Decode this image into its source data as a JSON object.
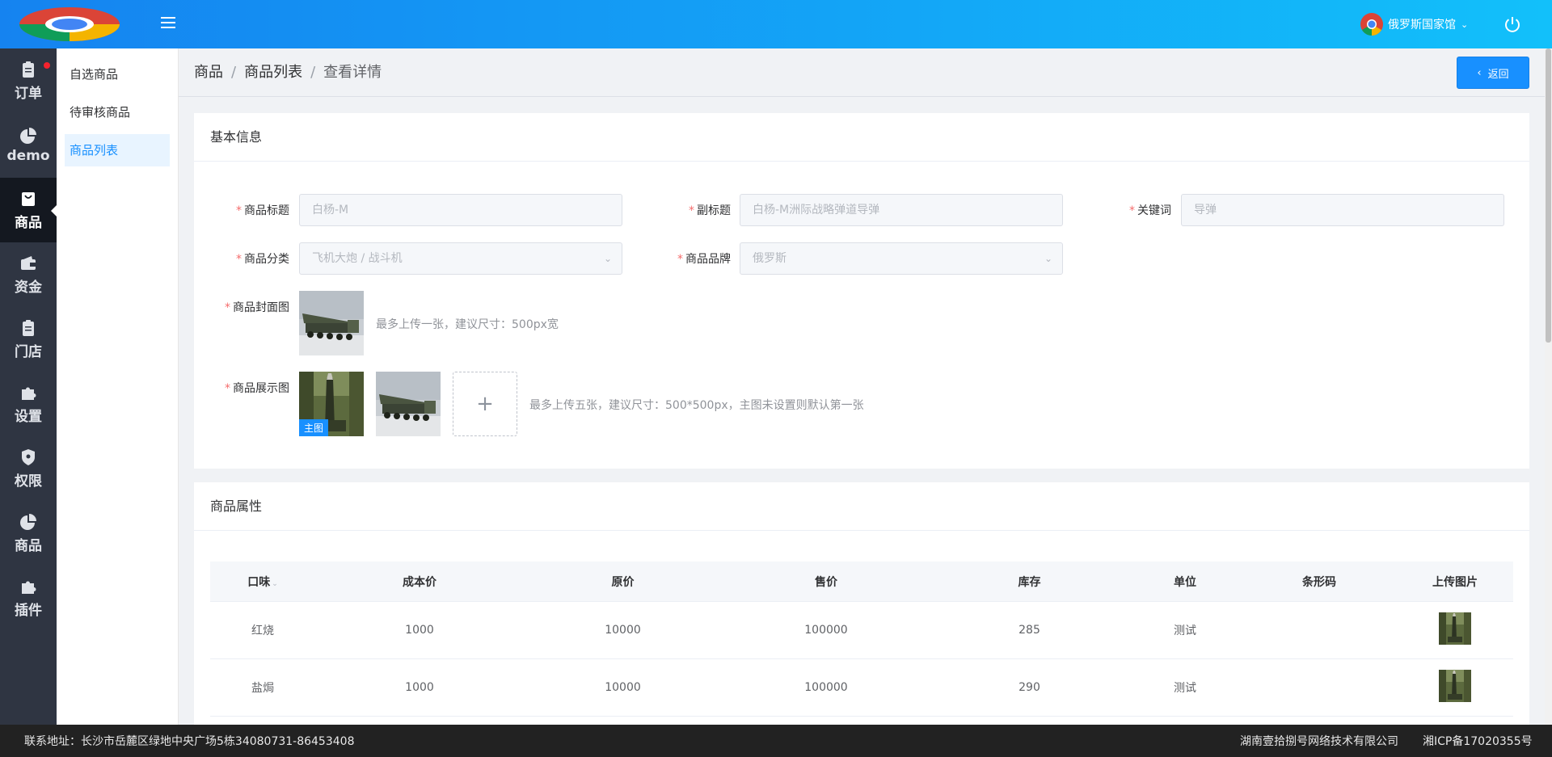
{
  "header": {
    "store_name": "俄罗斯国家馆"
  },
  "leftnav": {
    "items": [
      {
        "label": "订单",
        "icon": "clipboard-icon"
      },
      {
        "label": "demo",
        "icon": "pie-chart-icon"
      },
      {
        "label": "商品",
        "icon": "shopping-bag-icon"
      },
      {
        "label": "资金",
        "icon": "wallet-icon"
      },
      {
        "label": "门店",
        "icon": "clipboard-icon"
      },
      {
        "label": "设置",
        "icon": "puzzle-icon"
      },
      {
        "label": "权限",
        "icon": "shield-icon"
      },
      {
        "label": "商品",
        "icon": "pie-chart-icon"
      },
      {
        "label": "插件",
        "icon": "puzzle-icon"
      }
    ]
  },
  "subnav": {
    "items": [
      "自选商品",
      "待审核商品",
      "商品列表"
    ]
  },
  "breadcrumb": [
    "商品",
    "商品列表",
    "查看详情"
  ],
  "back_label": "返回",
  "basic": {
    "title": "基本信息",
    "fields": {
      "title_label": "商品标题",
      "title_value": "白杨-M",
      "subtitle_label": "副标题",
      "subtitle_value": "白杨-M洲际战略弹道导弹",
      "keyword_label": "关键词",
      "keyword_value": "导弹",
      "category_label": "商品分类",
      "category_value": "飞机大炮 / 战斗机",
      "brand_label": "商品品牌",
      "brand_value": "俄罗斯",
      "cover_label": "商品封面图",
      "cover_hint": "最多上传一张，建议尺寸：500px宽",
      "gallery_label": "商品展示图",
      "main_tag": "主图",
      "gallery_hint": "最多上传五张，建议尺寸：500*500px，主图未设置则默认第一张"
    }
  },
  "attrs": {
    "title": "商品属性",
    "columns": [
      "口味",
      "成本价",
      "原价",
      "售价",
      "库存",
      "单位",
      "条形码",
      "上传图片"
    ],
    "rows": [
      {
        "flavor": "红烧",
        "cost": "1000",
        "original": "10000",
        "price": "100000",
        "stock": "285",
        "unit": "测试",
        "barcode": ""
      },
      {
        "flavor": "盐焗",
        "cost": "1000",
        "original": "10000",
        "price": "100000",
        "stock": "290",
        "unit": "测试",
        "barcode": ""
      }
    ]
  },
  "footer": {
    "address": "联系地址：长沙市岳麓区绿地中央广场5栋34080731-86453408",
    "company": "湖南壹拾捌号网络技术有限公司",
    "icp": "湘ICP备17020355号"
  },
  "colors": {
    "primary": "#1890ff",
    "nav_bg": "#2f3542",
    "nav_active": "#141820",
    "required": "#f56c6c"
  }
}
